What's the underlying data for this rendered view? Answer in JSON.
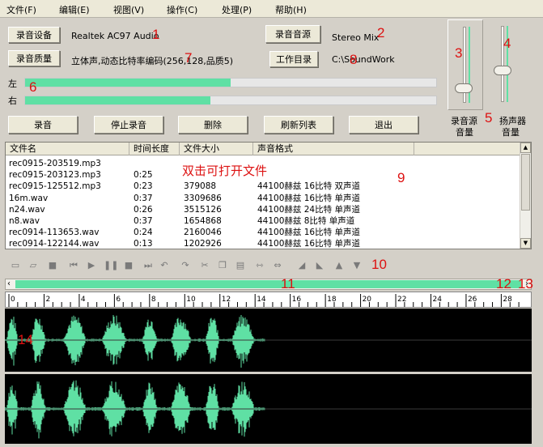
{
  "menu": [
    "文件(F)",
    "编辑(E)",
    "视图(V)",
    "操作(C)",
    "处理(P)",
    "帮助(H)"
  ],
  "device": {
    "record_device_button": "录音设备",
    "record_device_value": "Realtek AC97 Audio",
    "record_source_button": "录音音源",
    "record_source_value": "Stereo Mix",
    "record_quality_button": "录音质量",
    "record_quality_value": "立体声,动态比特率编码(256,128,品质5)",
    "work_dir_button": "工作目录",
    "work_dir_value": "C:\\SoundWork"
  },
  "levels": {
    "left_label": "左",
    "right_label": "右",
    "left_level": 0.5,
    "right_level": 0.45
  },
  "actions": {
    "record": "录音",
    "stop": "停止录音",
    "delete": "删除",
    "refresh": "刷新列表",
    "exit": "退出"
  },
  "sliders": {
    "source_volume_label_1": "录音源",
    "source_volume_label_2": "音量",
    "speaker_volume_label_1": "扬声器",
    "speaker_volume_label_2": "音量",
    "source_volume_level": 0.15,
    "speaker_volume_level": 0.4
  },
  "file_list": {
    "columns": [
      "文件名",
      "时间长度",
      "文件大小",
      "声音格式"
    ],
    "rows": [
      {
        "name": "rec0915-203519.mp3",
        "duration": "",
        "size": "",
        "format": ""
      },
      {
        "name": "rec0915-203123.mp3",
        "duration": "0:25",
        "size": "",
        "format": ""
      },
      {
        "name": "rec0915-125512.mp3",
        "duration": "0:23",
        "size": "379088",
        "format": "44100赫兹 16比特 双声道"
      },
      {
        "name": "16m.wav",
        "duration": "0:37",
        "size": "3309686",
        "format": "44100赫兹 16比特 单声道"
      },
      {
        "name": "n24.wav",
        "duration": "0:26",
        "size": "3515126",
        "format": "44100赫兹 24比特 单声道"
      },
      {
        "name": "n8.wav",
        "duration": "0:37",
        "size": "1654868",
        "format": "44100赫兹 8比特 单声道"
      },
      {
        "name": "rec0914-113653.wav",
        "duration": "0:24",
        "size": "2160046",
        "format": "44100赫兹 16比特 单声道"
      },
      {
        "name": "rec0914-122144.wav",
        "duration": "0:13",
        "size": "1202926",
        "format": "44100赫兹 16比特 单声道"
      }
    ],
    "hint": "双击可打开文件"
  },
  "toolbar_icons": [
    "open-icon",
    "open-folder-icon",
    "save-icon",
    "skip-start-icon",
    "play-icon",
    "pause-icon",
    "stop-icon",
    "skip-end-icon",
    "undo-icon",
    "redo-icon",
    "cut-icon",
    "copy-icon",
    "paste-icon",
    "trim-icon",
    "mix-icon",
    "fade-in-icon",
    "fade-out-icon",
    "volume-up-icon",
    "volume-down-icon"
  ],
  "timeline": {
    "ticks": [
      "0",
      "2",
      "4",
      "6",
      "8",
      "10",
      "12",
      "14",
      "16",
      "18",
      "20",
      "22",
      "24",
      "26",
      "28"
    ],
    "position": 1.0
  },
  "annotations": [
    "1",
    "2",
    "3",
    "4",
    "5",
    "6",
    "7",
    "8",
    "9",
    "10",
    "11",
    "12",
    "13",
    "14"
  ],
  "colors": {
    "accent_green": "#5fe0a4",
    "wave_bg": "#000000",
    "annotation_red": "#dd1111"
  }
}
